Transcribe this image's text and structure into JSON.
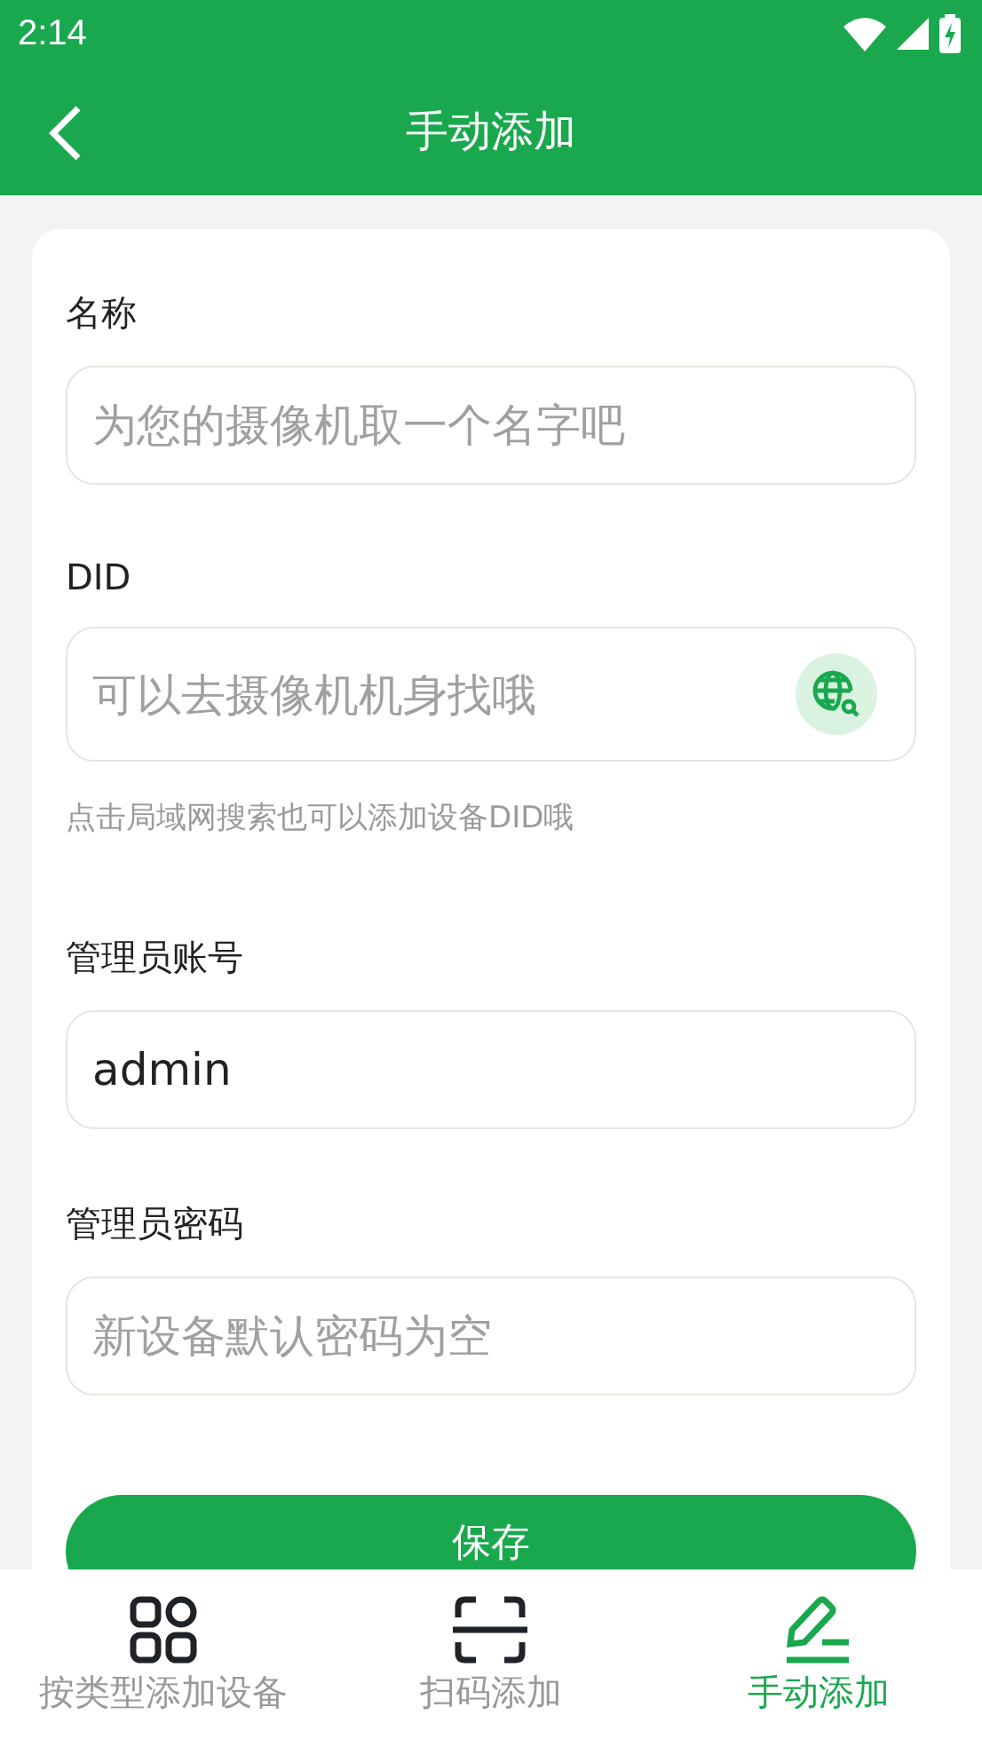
{
  "status_bar": {
    "time": "2:14"
  },
  "app_bar": {
    "title": "手动添加"
  },
  "form": {
    "fields": [
      {
        "label": "名称",
        "placeholder": "为您的摄像机取一个名字吧"
      },
      {
        "label": "DID",
        "placeholder": "可以去摄像机机身找哦",
        "hint": "点击局域网搜索也可以添加设备DID哦",
        "search_button": true
      },
      {
        "label": "管理员账号",
        "value": "admin"
      },
      {
        "label": "管理员密码",
        "placeholder": "新设备默认密码为空"
      }
    ],
    "save_button": "保存"
  },
  "bottom_nav": [
    {
      "label": "按类型添加设备",
      "selected": false
    },
    {
      "label": "扫码添加",
      "selected": false
    },
    {
      "label": "手动添加",
      "selected": true
    }
  ]
}
